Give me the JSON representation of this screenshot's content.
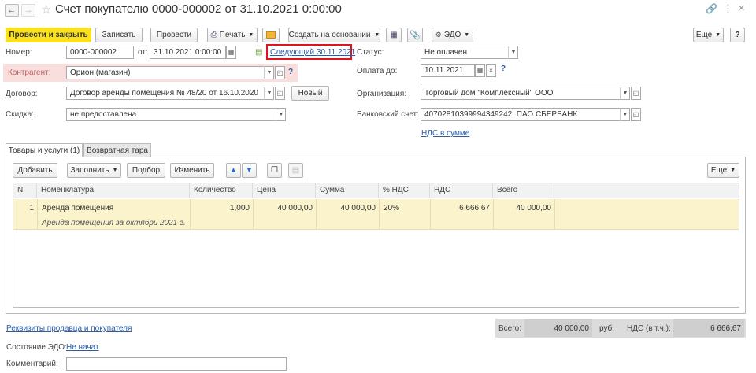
{
  "window": {
    "title": "Счет покупателю 0000-000002 от 31.10.2021 0:00:00"
  },
  "toolbar": {
    "post_close": "Провести и закрыть",
    "save": "Записать",
    "post": "Провести",
    "print": "Печать",
    "create_based": "Создать на основании",
    "edo": "ЭДО",
    "more": "Еще",
    "help": "?"
  },
  "form": {
    "number_label": "Номер:",
    "number_value": "0000-000002",
    "date_label": "от:",
    "date_value": "31.10.2021  0:00:00",
    "next_link": "Следующий 30.11.2021",
    "status_label": "Статус:",
    "status_value": "Не оплачен",
    "counterparty_label": "Контрагент:",
    "counterparty_value": "Орион (магазин)",
    "pay_until_label": "Оплата до:",
    "pay_until_value": "10.11.2021",
    "contract_label": "Договор:",
    "contract_value": "Договор аренды помещения № 48/20 от 16.10.2020",
    "new_button": "Новый",
    "organization_label": "Организация:",
    "organization_value": "Торговый дом \"Комплексный\" ООО",
    "discount_label": "Скидка:",
    "discount_value": "не предоставлена",
    "bank_label": "Банковский счет:",
    "bank_value": "40702810399994349242, ПАО СБЕРБАНК",
    "vat_link": "НДС в сумме"
  },
  "tabs": [
    {
      "label": "Товары и услуги (1)"
    },
    {
      "label": "Возвратная тара"
    }
  ],
  "table_toolbar": {
    "add": "Добавить",
    "fill": "Заполнить",
    "select": "Подбор",
    "change": "Изменить",
    "more": "Еще"
  },
  "table": {
    "columns": [
      "N",
      "Номенклатура",
      "Количество",
      "Цена",
      "Сумма",
      "% НДС",
      "НДС",
      "Всего"
    ],
    "rows": [
      {
        "n": "1",
        "item": "Аренда помещения",
        "item_note": "Аренда помещения за октябрь 2021 г.",
        "qty": "1,000",
        "price": "40 000,00",
        "sum": "40 000,00",
        "vat_rate": "20%",
        "vat": "6 666,67",
        "total": "40 000,00"
      }
    ]
  },
  "footer": {
    "requisites_link": "Реквизиты продавца и покупателя",
    "total_label": "Всего:",
    "total_value": "40 000,00",
    "currency": "руб.",
    "vat_label": "НДС (в т.ч.):",
    "vat_value": "6 666,67",
    "edo_state_label": "Состояние ЭДО:",
    "edo_state_value": "Не начат",
    "comment_label": "Комментарий:",
    "comment_value": ""
  },
  "colors": {
    "primary_button": "#fbe11c",
    "row_highlight": "#fbf3cc",
    "counterparty_bg": "#f9dede",
    "highlight_frame": "#e0141e",
    "link": "#2a5ca8"
  }
}
